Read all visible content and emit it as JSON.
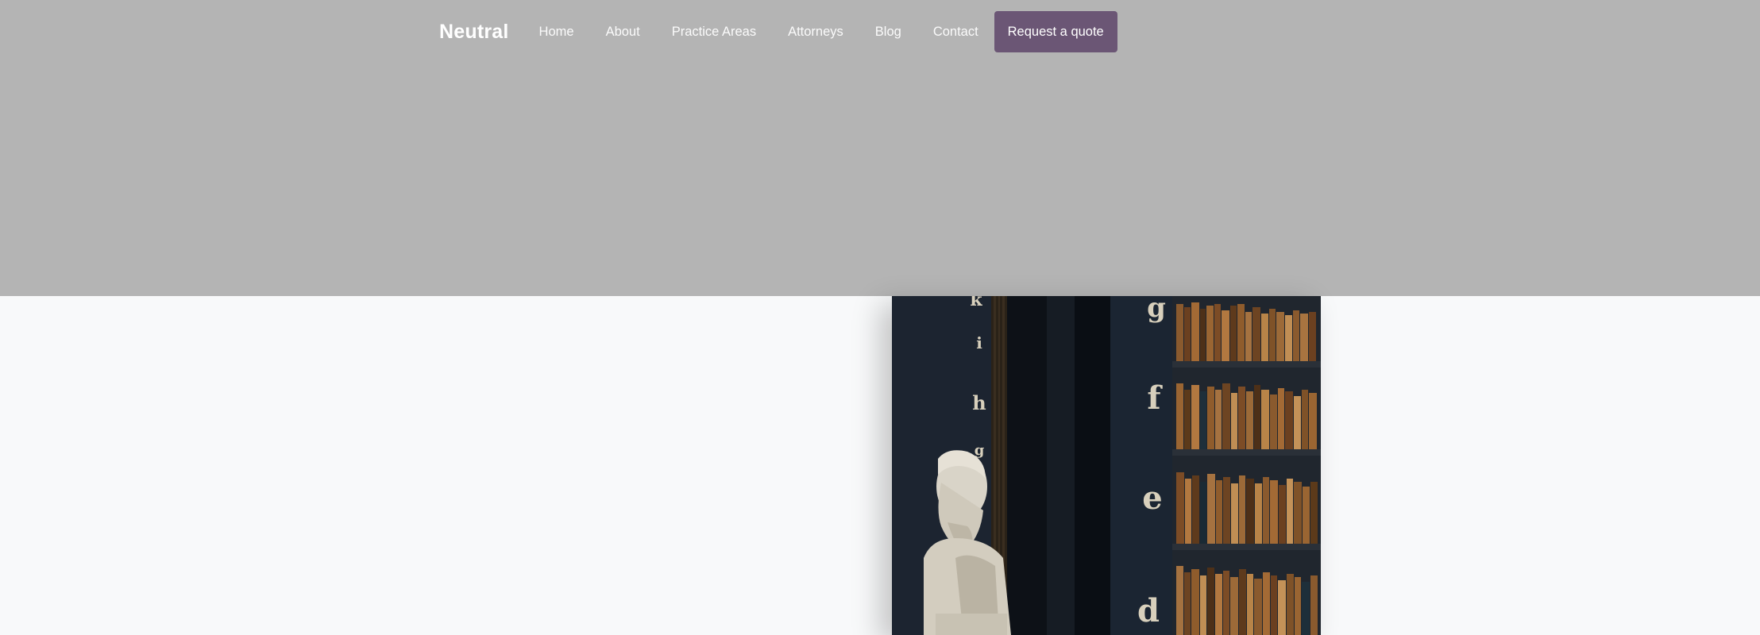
{
  "header": {
    "brand": "Neutral",
    "nav": [
      {
        "label": "Home"
      },
      {
        "label": "About"
      },
      {
        "label": "Practice Areas"
      },
      {
        "label": "Attorneys"
      },
      {
        "label": "Blog"
      },
      {
        "label": "Contact"
      }
    ],
    "cta_label": "Request a quote"
  },
  "colors": {
    "hero_overlay": "#b4b4b4",
    "cta": "#6b5675",
    "page_bg": "#f8f9fa"
  },
  "hero_image": {
    "subject": "library-bust-photo",
    "letters_left": [
      "k",
      "i",
      "h",
      "g"
    ],
    "letters_right": [
      "g",
      "f",
      "e",
      "d"
    ]
  }
}
